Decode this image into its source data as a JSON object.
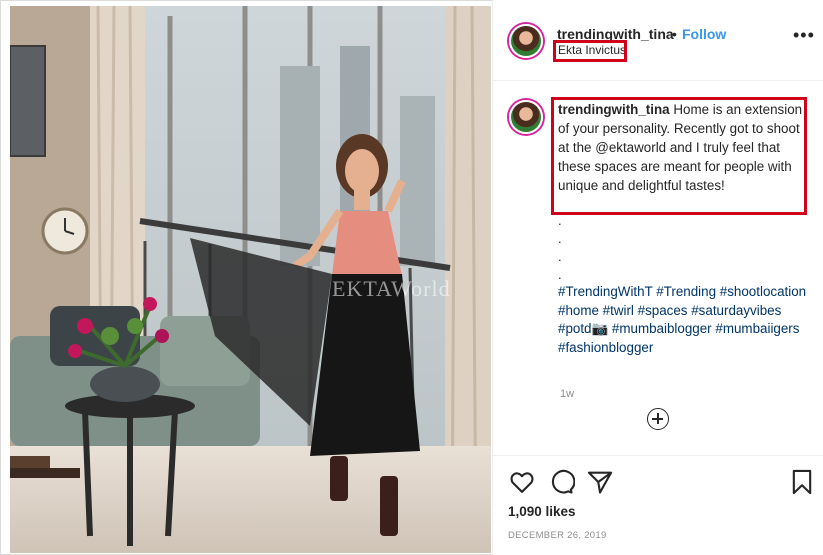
{
  "post": {
    "username": "trendingwith_tina",
    "separator": "•",
    "follow_label": "Follow",
    "location": "Ekta Invictus",
    "more_label": "•••",
    "caption_username": "trendingwith_tina",
    "caption_text": "Home is an extension of your personality. Recently got to shoot at the @ektaworld and I truly feel that these spaces are meant for people with unique and delightful tastes!",
    "caption_dots": [
      ".",
      ".",
      ".",
      "."
    ],
    "hashtags": "#TrendingWithT #Trending #shootlocation #home #twirl #spaces #saturdayvibes #potd📷 #mumbaiblogger #mumbaiigers #fashionblogger",
    "age": "1w",
    "likes": "1,090 likes",
    "date": "DECEMBER 26, 2019",
    "watermark": "EKTAWorld"
  },
  "icons": {
    "like": "heart-icon",
    "comment": "comment-icon",
    "share": "share-icon",
    "save": "bookmark-icon",
    "more": "more-icon",
    "load_more": "plus-circle-icon"
  },
  "colors": {
    "follow": "#3897f0",
    "highlight_box": "#d0021b",
    "hashtag": "#003569",
    "muted": "#8e8e8e"
  }
}
